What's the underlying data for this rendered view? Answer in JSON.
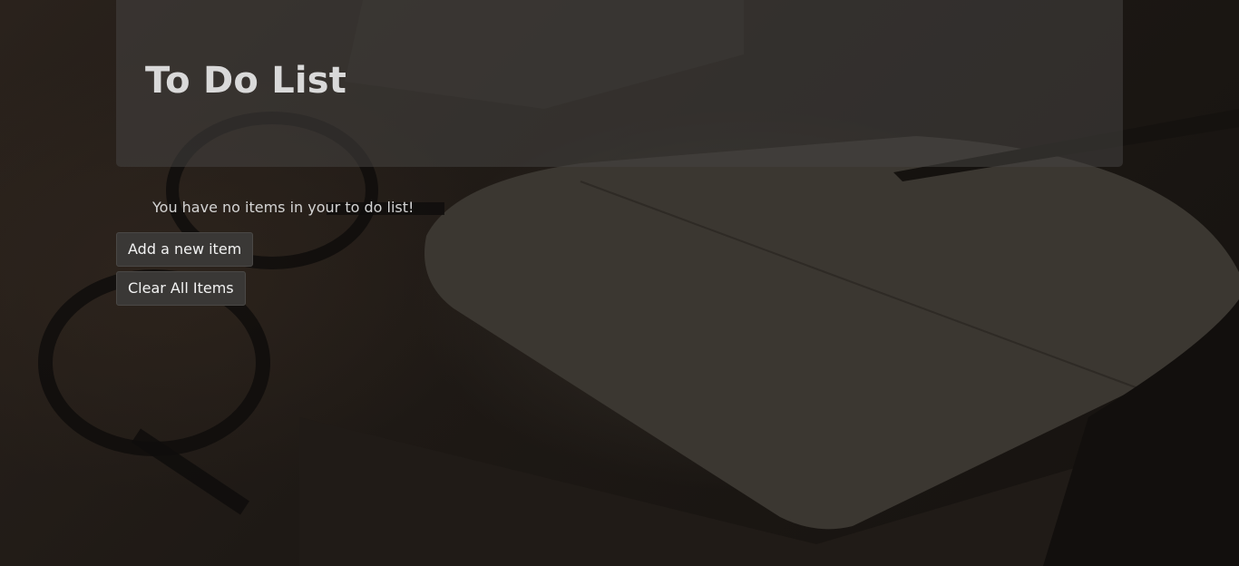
{
  "header": {
    "title": "To Do List"
  },
  "main": {
    "empty_message": "You have no items in your to do list!",
    "add_button_label": "Add a new item",
    "clear_button_label": "Clear All Items"
  },
  "colors": {
    "panel": "#464442",
    "text": "#d9d9d9",
    "button": "#3a3836"
  }
}
